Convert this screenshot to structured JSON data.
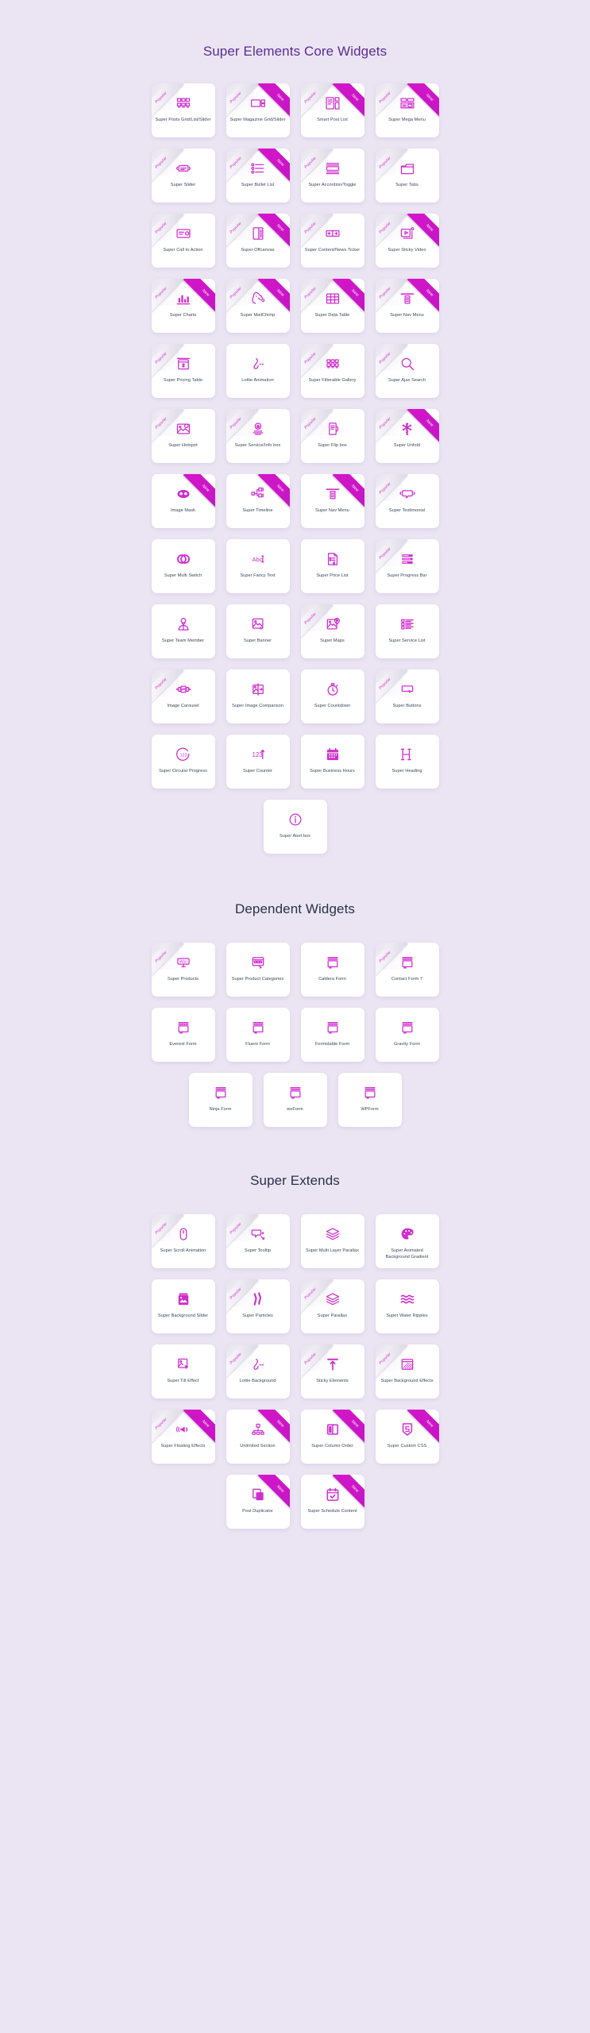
{
  "background_color": "#ebe5f3",
  "accent_color": "#cf2ecf",
  "title_color": "#27324a",
  "title_accent_color": "#5b2b91",
  "badges": {
    "popular": "Popular",
    "new": "New"
  },
  "sections": [
    {
      "id": "core",
      "title": "Super Elements Core Widgets",
      "title_style": "accent",
      "rows": [
        [
          {
            "label": "Super Posts Grid/List/Slider",
            "icon": "grid-icon",
            "popular": true,
            "new": false
          },
          {
            "label": "Super Magazine Grid/Slider",
            "icon": "magazine-icon",
            "popular": true,
            "new": true
          },
          {
            "label": "Smart Post List",
            "icon": "post-list-icon",
            "popular": true,
            "new": true
          },
          {
            "label": "Super Mega Menu",
            "icon": "mega-menu-icon",
            "popular": true,
            "new": true
          }
        ],
        [
          {
            "label": "Super Slider",
            "icon": "slider-icon",
            "popular": true,
            "new": false
          },
          {
            "label": "Super Bullet List",
            "icon": "bullet-list-icon",
            "popular": true,
            "new": true
          },
          {
            "label": "Super Accordion/Toggle",
            "icon": "accordion-icon",
            "popular": true,
            "new": false
          },
          {
            "label": "Super Tabs",
            "icon": "tabs-icon",
            "popular": true,
            "new": false
          }
        ],
        [
          {
            "label": "Super Call to Action",
            "icon": "call-to-action-icon",
            "popular": true,
            "new": false
          },
          {
            "label": "Super Offcanvas",
            "icon": "offcanvas-icon",
            "popular": true,
            "new": true
          },
          {
            "label": "Super Content/News Ticker",
            "icon": "news-ticker-icon",
            "popular": true,
            "new": false
          },
          {
            "label": "Super Sticky Video",
            "icon": "sticky-video-icon",
            "popular": true,
            "new": true
          }
        ],
        [
          {
            "label": "Super Charts",
            "icon": "bar-chart-icon",
            "popular": true,
            "new": true
          },
          {
            "label": "Super MailChimp",
            "icon": "mailchimp-icon",
            "popular": true,
            "new": true
          },
          {
            "label": "Super Data Table",
            "icon": "data-table-icon",
            "popular": true,
            "new": true
          },
          {
            "label": "Super Nav Menu",
            "icon": "nav-menu-icon",
            "popular": true,
            "new": true
          }
        ],
        [
          {
            "label": "Super Pricing Table",
            "icon": "pricing-table-icon",
            "popular": true,
            "new": false
          },
          {
            "label": "Lottie Animation",
            "icon": "lottie-icon",
            "popular": false,
            "new": false
          },
          {
            "label": "Super Filterable Gallery",
            "icon": "filterable-gallery-icon",
            "popular": true,
            "new": false
          },
          {
            "label": "Super Ajax Search",
            "icon": "search-icon",
            "popular": true,
            "new": false
          }
        ],
        [
          {
            "label": "Super Hotspot",
            "icon": "hotspot-icon",
            "popular": true,
            "new": false
          },
          {
            "label": "Super Service/Info box",
            "icon": "service-info-icon",
            "popular": true,
            "new": false
          },
          {
            "label": "Super Flip box",
            "icon": "flip-box-icon",
            "popular": true,
            "new": false
          },
          {
            "label": "Super Unfold",
            "icon": "unfold-icon",
            "popular": true,
            "new": true
          }
        ],
        [
          {
            "label": "Image Mask",
            "icon": "image-mask-icon",
            "popular": false,
            "new": true
          },
          {
            "label": "Super Timeline",
            "icon": "timeline-icon",
            "popular": false,
            "new": true
          },
          {
            "label": "Super Nav Menu",
            "icon": "nav-menu-icon",
            "popular": false,
            "new": true
          },
          {
            "label": "Super Testimonial",
            "icon": "testimonial-icon",
            "popular": true,
            "new": false
          }
        ],
        [
          {
            "label": "Super Multi Switch",
            "icon": "multi-switch-icon",
            "popular": false,
            "new": false
          },
          {
            "label": "Super Fancy Text",
            "icon": "fancy-text-icon",
            "popular": false,
            "new": false
          },
          {
            "label": "Super Price List",
            "icon": "price-list-icon",
            "popular": false,
            "new": false
          },
          {
            "label": "Super Progress Bar",
            "icon": "progress-bar-icon",
            "popular": true,
            "new": false
          }
        ],
        [
          {
            "label": "Super Team Member",
            "icon": "team-member-icon",
            "popular": false,
            "new": false
          },
          {
            "label": "Super Banner",
            "icon": "banner-icon",
            "popular": false,
            "new": false
          },
          {
            "label": "Super Maps",
            "icon": "maps-icon",
            "popular": true,
            "new": false
          },
          {
            "label": "Super Service List",
            "icon": "service-list-icon",
            "popular": false,
            "new": false
          }
        ],
        [
          {
            "label": "Image Carousel",
            "icon": "image-carousel-icon",
            "popular": true,
            "new": false
          },
          {
            "label": "Super Image Comparison",
            "icon": "image-comparison-icon",
            "popular": false,
            "new": false
          },
          {
            "label": "Super Countdown",
            "icon": "countdown-icon",
            "popular": false,
            "new": false
          },
          {
            "label": "Super Buttons",
            "icon": "buttons-icon",
            "popular": true,
            "new": false
          }
        ],
        [
          {
            "label": "Super Circular Progress",
            "icon": "circular-progress-icon",
            "popular": false,
            "new": false
          },
          {
            "label": "Super Counter",
            "icon": "counter-icon",
            "popular": false,
            "new": false
          },
          {
            "label": "Super Business Hours",
            "icon": "business-hours-icon",
            "popular": false,
            "new": false
          },
          {
            "label": "Super Heading",
            "icon": "heading-icon",
            "popular": false,
            "new": false
          }
        ],
        [
          {
            "label": "Super Alert box",
            "icon": "alert-box-icon",
            "popular": false,
            "new": false
          }
        ]
      ]
    },
    {
      "id": "dependent",
      "title": "Dependent Widgets",
      "title_style": "plain",
      "rows": [
        [
          {
            "label": "Super Products",
            "icon": "woo-icon",
            "popular": true,
            "new": false
          },
          {
            "label": "Super Product Categories",
            "icon": "product-categories-icon",
            "popular": false,
            "new": false
          },
          {
            "label": "Caldera Form",
            "icon": "form-icon",
            "popular": false,
            "new": false
          },
          {
            "label": "Contact Form 7",
            "icon": "form-icon",
            "popular": true,
            "new": false
          }
        ],
        [
          {
            "label": "Everest Form",
            "icon": "form-icon",
            "popular": false,
            "new": false
          },
          {
            "label": "Fluent Form",
            "icon": "form-icon",
            "popular": false,
            "new": false
          },
          {
            "label": "Formidable Form",
            "icon": "form-icon",
            "popular": false,
            "new": false
          },
          {
            "label": "Gravity Form",
            "icon": "form-icon",
            "popular": false,
            "new": false
          }
        ],
        [
          {
            "label": "Ninja Form",
            "icon": "form-icon",
            "popular": false,
            "new": false
          },
          {
            "label": "weForm",
            "icon": "form-icon",
            "popular": false,
            "new": false
          },
          {
            "label": "WPForm",
            "icon": "form-icon",
            "popular": false,
            "new": false
          }
        ]
      ]
    },
    {
      "id": "extends",
      "title": "Super Extends",
      "title_style": "plain",
      "rows": [
        [
          {
            "label": "Super Scroll Animation",
            "icon": "mouse-icon",
            "popular": true,
            "new": false
          },
          {
            "label": "Super Tooltip",
            "icon": "tooltip-icon",
            "popular": true,
            "new": false
          },
          {
            "label": "Super Multi Layer Parallax",
            "icon": "layers-icon",
            "popular": false,
            "new": false
          },
          {
            "label": "Super Animated Background Gradient",
            "icon": "palette-icon",
            "popular": false,
            "new": false
          }
        ],
        [
          {
            "label": "Super Background Slider",
            "icon": "background-slider-icon",
            "popular": false,
            "new": false
          },
          {
            "label": "Super Particles",
            "icon": "particles-icon",
            "popular": true,
            "new": false
          },
          {
            "label": "Super Parallax",
            "icon": "layers-icon",
            "popular": true,
            "new": false
          },
          {
            "label": "Super Water Ripples",
            "icon": "water-ripples-icon",
            "popular": false,
            "new": false
          }
        ],
        [
          {
            "label": "Super Tilt Effect",
            "icon": "tilt-effect-icon",
            "popular": false,
            "new": false
          },
          {
            "label": "Lottie Background",
            "icon": "lottie-icon",
            "popular": true,
            "new": false
          },
          {
            "label": "Sticky Elements",
            "icon": "sticky-elements-icon",
            "popular": true,
            "new": false
          },
          {
            "label": "Super Background Effects",
            "icon": "background-effects-icon",
            "popular": true,
            "new": false
          }
        ],
        [
          {
            "label": "Super Floating Effects",
            "icon": "floating-effects-icon",
            "popular": true,
            "new": true
          },
          {
            "label": "Unlimited Section",
            "icon": "unlimited-section-icon",
            "popular": false,
            "new": true
          },
          {
            "label": "Super Column Order",
            "icon": "column-order-icon",
            "popular": false,
            "new": true
          },
          {
            "label": "Super Custom CSS",
            "icon": "css-icon",
            "popular": false,
            "new": true
          }
        ],
        [
          {
            "label": "Post Duplicator",
            "icon": "duplicate-icon",
            "popular": false,
            "new": true
          },
          {
            "label": "Super Schedule Content",
            "icon": "schedule-icon",
            "popular": false,
            "new": true
          }
        ]
      ]
    }
  ]
}
